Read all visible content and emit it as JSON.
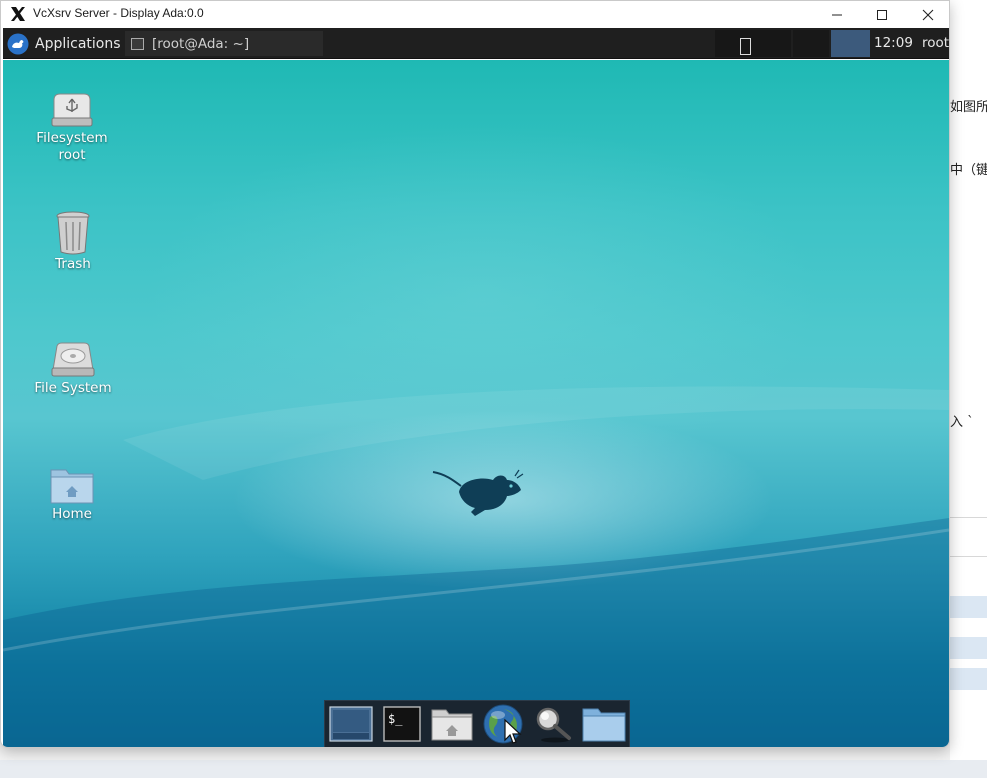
{
  "host": {
    "text_fragments": [
      "如图所",
      "中（键",
      "入 `"
    ]
  },
  "window": {
    "title": "VcXsrv Server - Display Ada:0.0"
  },
  "panel": {
    "applications_label": "Applications",
    "task_label": "[root@Ada: ~]",
    "clock": "12:09",
    "user": "root"
  },
  "desktop": {
    "icons": [
      {
        "label_line1": "Filesystem",
        "label_line2": "root",
        "icon": "usb-drive-icon"
      },
      {
        "label": "Trash",
        "icon": "trash-icon"
      },
      {
        "label": "File System",
        "icon": "hard-disk-icon"
      },
      {
        "label": "Home",
        "icon": "home-folder-icon"
      }
    ]
  },
  "dock": {
    "items": [
      {
        "name": "show-desktop",
        "icon": "desktop-icon"
      },
      {
        "name": "terminal",
        "icon": "terminal-icon",
        "glyph": "$_"
      },
      {
        "name": "file-manager",
        "icon": "home-folder-icon"
      },
      {
        "name": "web-browser",
        "icon": "globe-icon"
      },
      {
        "name": "app-finder",
        "icon": "magnifier-icon"
      },
      {
        "name": "folder",
        "icon": "folder-icon"
      }
    ]
  },
  "colors": {
    "panel_bg": "#1f1f1f",
    "workspace_active": "#3c5a7c",
    "desktop_top": "#1fb9b4",
    "desktop_bottom": "#0a6d95"
  }
}
